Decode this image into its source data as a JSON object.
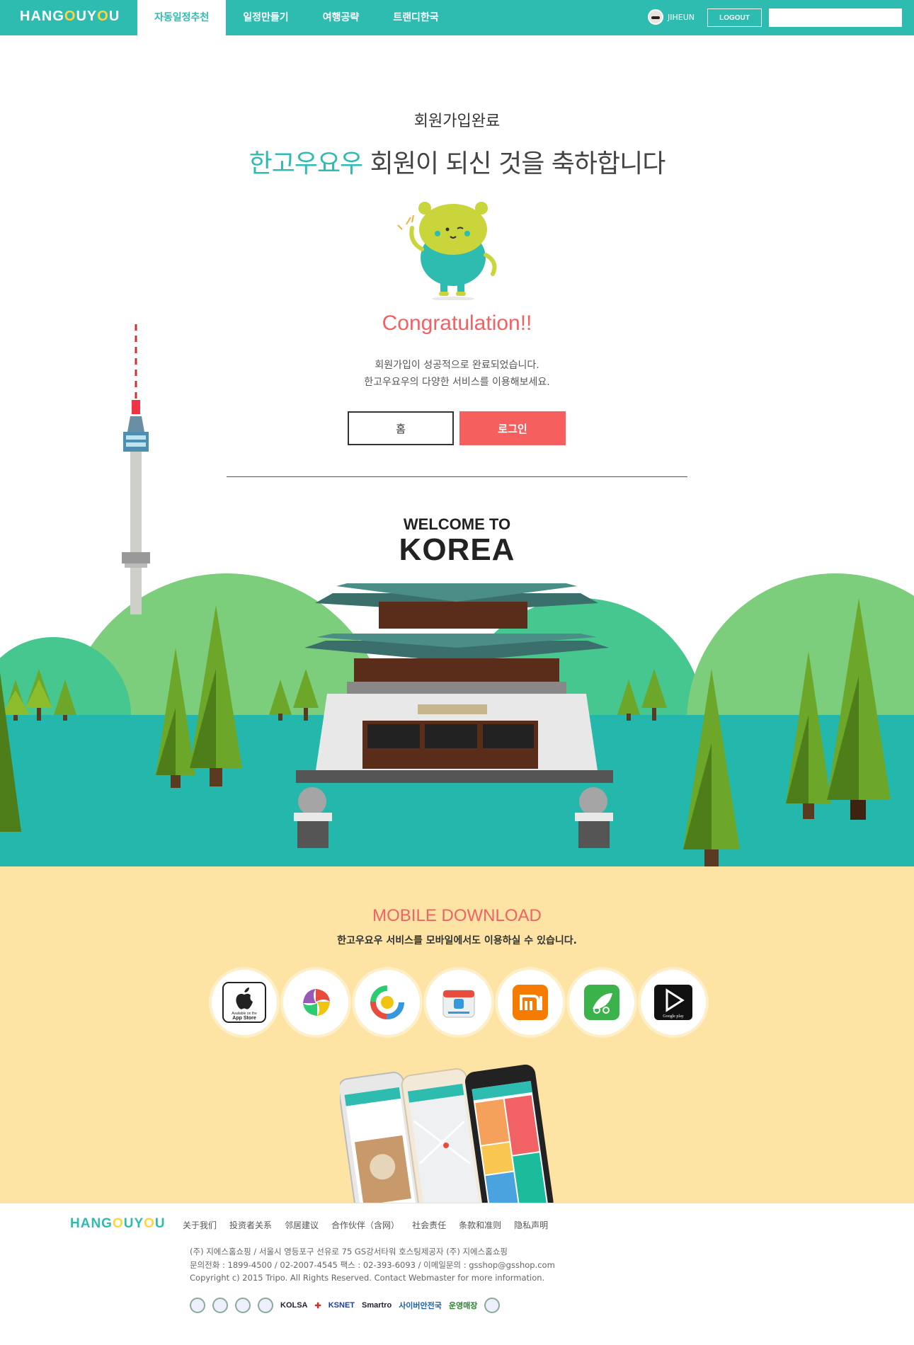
{
  "header": {
    "logo_pre": "HANG",
    "logo_o": "O",
    "logo_post": "UY",
    "logo_o2": "O",
    "logo_end": "U",
    "nav": [
      "자동일정추천",
      "일정만들기",
      "여행공략",
      "트랜디한국"
    ],
    "username": "JIHEUN",
    "logout": "LOGOUT",
    "search_value": ""
  },
  "welcome": {
    "subtitle": "회원가입완료",
    "headline_brand": "한고우요우",
    "headline_rest": " 회원이 되신 것을 축하합니다",
    "congrats": "Congratulation!!",
    "message_1": "회원가입이 성공적으로 완료되었습니다.",
    "message_2": "한고우요우의 다양한 서비스를 이용해보세요.",
    "home_button": "홈",
    "login_button": "로그인",
    "welcome_to": "WELCOME TO",
    "korea": "KOREA"
  },
  "mobile": {
    "title": "MOBILE DOWNLOAD",
    "subtitle": "한고우요우 서비스를 모바일에서도 이용하실 수 있습니다.",
    "stores": [
      "app-store-icon",
      "market-icon-1",
      "market-icon-2",
      "market-icon-3",
      "xiaomi-icon",
      "market-icon-5",
      "google-play-icon"
    ],
    "appstore_small": "Available on the",
    "appstore_big": "App Store",
    "googleplay_label": "Google play"
  },
  "footer": {
    "logo_pre": "HANG",
    "logo_o": "O",
    "logo_post": "UY",
    "logo_o2": "O",
    "logo_end": "U",
    "links": [
      "关于我们",
      "投资者关系",
      "邻居建议",
      "合作伙伴（含网）",
      "社会责任",
      "条款和准则",
      "隐私声明"
    ],
    "info_1": "(주) 지에스홈쇼핑  / 서울시 영등포구 선유로 75 GS강서타워 호스팅제공자 (주) 지에스홈쇼핑",
    "info_2": "문의전화 : 1899-4500 / 02-2007-4545 팩스 : 02-393-6093 / 이메일문의 : gsshop@gsshop.com",
    "info_3": "Copyright c) 2015 Tripo. All Rights Reserved. Contact Webmaster for more information.",
    "cert_1": "KOLSA",
    "cert_2": "KSNET",
    "cert_3": "Smartro",
    "cert_4": "사이버안전국",
    "cert_5": "운영매장"
  },
  "colors": {
    "teal": "#2fbcb0",
    "coral": "#f26163",
    "yellow_bg": "#fde4a5",
    "grass_light": "#7ccd7c",
    "water": "#24b8ad"
  }
}
